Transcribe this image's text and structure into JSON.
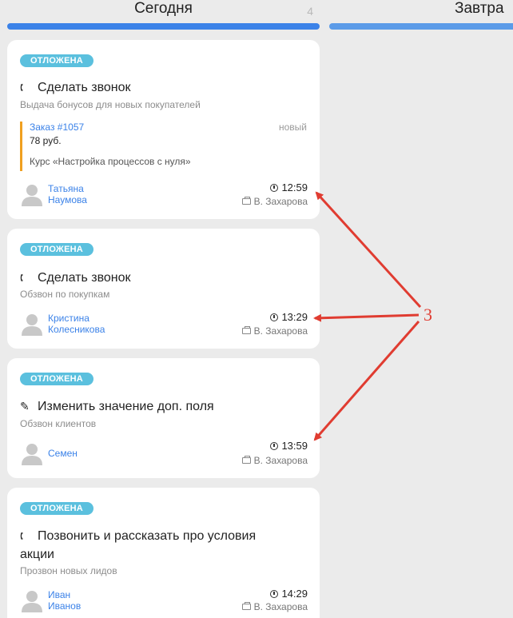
{
  "columns": {
    "today": {
      "title": "Сегодня",
      "count": "4"
    },
    "tomorrow": {
      "title": "Завтра"
    }
  },
  "cards": [
    {
      "badge": "ОТЛОЖЕНА",
      "icon": "phone-icon",
      "title": "Сделать звонок",
      "subtitle": "Выдача бонусов для новых покупателей",
      "order": {
        "link": "Заказ #1057",
        "status": "новый",
        "price": "78 руб.",
        "course": "Курс «Настройка процессов с нуля»"
      },
      "person": [
        "Татьяна",
        "Наумова"
      ],
      "time": "12:59",
      "manager": "В. Захарова"
    },
    {
      "badge": "ОТЛОЖЕНА",
      "icon": "phone-icon",
      "title": "Сделать звонок",
      "subtitle": "Обзвон по покупкам",
      "person": [
        "Кристина",
        "Колесникова"
      ],
      "time": "13:29",
      "manager": "В. Захарова"
    },
    {
      "badge": "ОТЛОЖЕНА",
      "icon": "edit-icon",
      "title": "Изменить значение доп. поля",
      "subtitle": "Обзвон клиентов",
      "person": [
        "Семен"
      ],
      "time": "13:59",
      "manager": "В. Захарова"
    },
    {
      "badge": "ОТЛОЖЕНА",
      "icon": "phone-icon",
      "title_lines": [
        "Позвонить и рассказать про условия",
        "акции"
      ],
      "subtitle": "Прозвон новых лидов",
      "person": [
        "Иван",
        "Иванов"
      ],
      "time": "14:29",
      "manager": "В. Захарова"
    }
  ],
  "annotation": {
    "label": "3",
    "color": "#e03c31"
  },
  "colors": {
    "accent": "#3b82e8",
    "badge": "#5bc0de",
    "order_bar": "#f0a020"
  }
}
